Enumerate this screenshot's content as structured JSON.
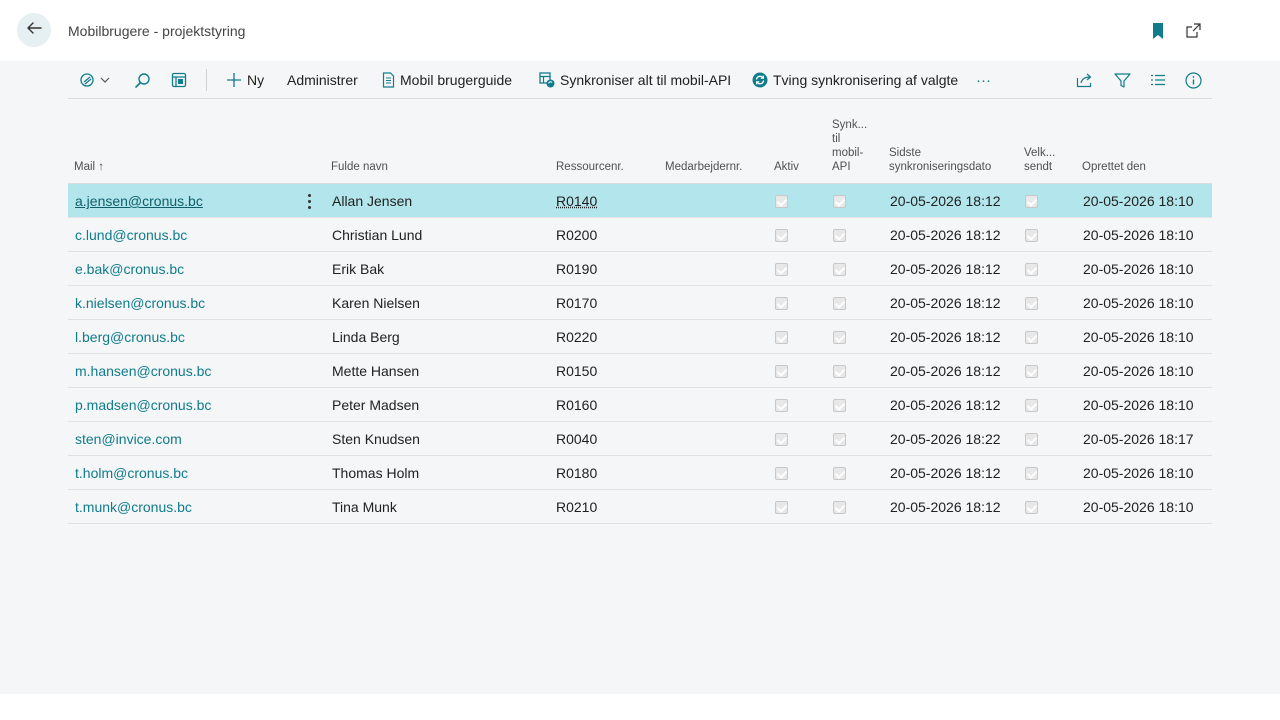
{
  "page": {
    "title": "Mobilbrugere - projektstyring"
  },
  "icons": {
    "back": "arrow-left-icon",
    "bookmark": "bookmark-icon",
    "popout": "open-in-new-window-icon",
    "views": "views-icon",
    "search": "search-icon",
    "edit_list": "edit-list-icon",
    "new": "plus-icon",
    "guide": "document-icon",
    "sync_all": "sync-all-icon",
    "force_sync": "refresh-icon",
    "share": "share-icon",
    "filter": "filter-icon",
    "list_view": "list-view-icon",
    "info": "info-icon"
  },
  "colors": {
    "accent": "#107c8c",
    "selected_row": "#b3e6ec",
    "back_button_bg": "#e6eff2"
  },
  "actions": {
    "new_label": "Ny",
    "manage_label": "Administrer",
    "guide_label": "Mobil brugerguide",
    "sync_all_label": "Synkroniser alt til mobil-API",
    "force_sync_label": "Tving synkronisering af valgte",
    "more_label": "···"
  },
  "columns": {
    "mail": "Mail ↑",
    "name": "Fulde navn",
    "resource": "Ressourcenr.",
    "employee": "Medarbejdernr.",
    "active": "Aktiv",
    "sync": [
      "Synk...",
      "til",
      "mobil-",
      "API"
    ],
    "last_sync": [
      "Sidste",
      "synkroniseringsdato"
    ],
    "welcome": [
      "Velk...",
      "sendt"
    ],
    "created": "Oprettet den"
  },
  "rows": [
    {
      "mail": "a.jensen@cronus.bc",
      "name": "Allan Jensen",
      "resource": "R0140",
      "employee": "",
      "active": true,
      "sync": true,
      "last_sync": "20-05-2026 18:12",
      "welcome": true,
      "created": "20-05-2026 18:10"
    },
    {
      "mail": "c.lund@cronus.bc",
      "name": "Christian Lund",
      "resource": "R0200",
      "employee": "",
      "active": true,
      "sync": true,
      "last_sync": "20-05-2026 18:12",
      "welcome": true,
      "created": "20-05-2026 18:10"
    },
    {
      "mail": "e.bak@cronus.bc",
      "name": "Erik Bak",
      "resource": "R0190",
      "employee": "",
      "active": true,
      "sync": true,
      "last_sync": "20-05-2026 18:12",
      "welcome": true,
      "created": "20-05-2026 18:10"
    },
    {
      "mail": "k.nielsen@cronus.bc",
      "name": "Karen Nielsen",
      "resource": "R0170",
      "employee": "",
      "active": true,
      "sync": true,
      "last_sync": "20-05-2026 18:12",
      "welcome": true,
      "created": "20-05-2026 18:10"
    },
    {
      "mail": "l.berg@cronus.bc",
      "name": "Linda Berg",
      "resource": "R0220",
      "employee": "",
      "active": true,
      "sync": true,
      "last_sync": "20-05-2026 18:12",
      "welcome": true,
      "created": "20-05-2026 18:10"
    },
    {
      "mail": "m.hansen@cronus.bc",
      "name": "Mette Hansen",
      "resource": "R0150",
      "employee": "",
      "active": true,
      "sync": true,
      "last_sync": "20-05-2026 18:12",
      "welcome": true,
      "created": "20-05-2026 18:10"
    },
    {
      "mail": "p.madsen@cronus.bc",
      "name": "Peter Madsen",
      "resource": "R0160",
      "employee": "",
      "active": true,
      "sync": true,
      "last_sync": "20-05-2026 18:12",
      "welcome": true,
      "created": "20-05-2026 18:10"
    },
    {
      "mail": "sten@invice.com",
      "name": "Sten Knudsen",
      "resource": "R0040",
      "employee": "",
      "active": true,
      "sync": true,
      "last_sync": "20-05-2026 18:22",
      "welcome": true,
      "created": "20-05-2026 18:17"
    },
    {
      "mail": "t.holm@cronus.bc",
      "name": "Thomas Holm",
      "resource": "R0180",
      "employee": "",
      "active": true,
      "sync": true,
      "last_sync": "20-05-2026 18:12",
      "welcome": true,
      "created": "20-05-2026 18:10"
    },
    {
      "mail": "t.munk@cronus.bc",
      "name": "Tina Munk",
      "resource": "R0210",
      "employee": "",
      "active": true,
      "sync": true,
      "last_sync": "20-05-2026 18:12",
      "welcome": true,
      "created": "20-05-2026 18:10"
    }
  ]
}
